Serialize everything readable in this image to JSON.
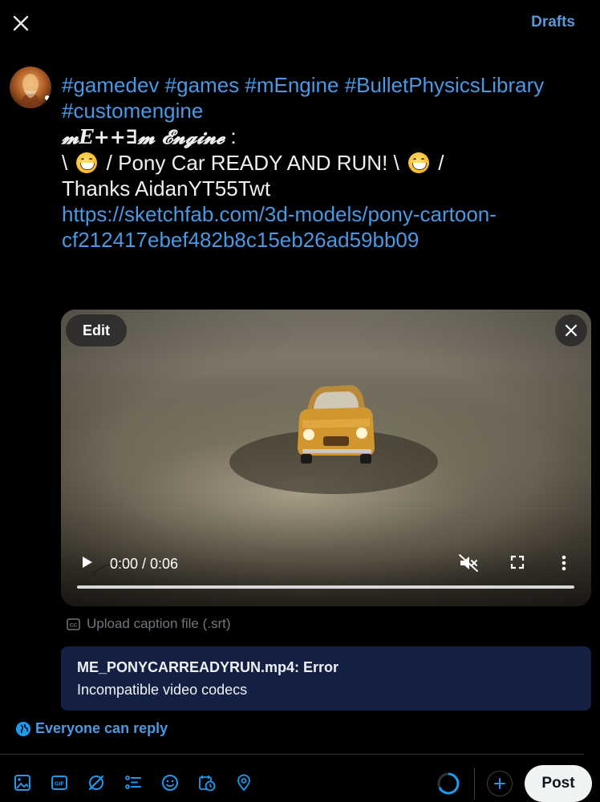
{
  "header": {
    "close_icon": "close-icon",
    "drafts_label": "Drafts"
  },
  "composer": {
    "line1": {
      "tag_gamedev": "#gamedev",
      "tag_games": "#games",
      "tag_mengine": "#mEngine",
      "tag_bullet": "#BulletPhysicsLibrary"
    },
    "line2": {
      "tag_customengine": "#customengine"
    },
    "line3": {
      "fancy_text": "𝓶E++∃𝓶 𝓔𝓷𝓰𝓲𝓷𝓮",
      "suffix": " :"
    },
    "line4": {
      "part1": "\\ ",
      "part2": " / Pony Car READY AND RUN! \\ ",
      "part3": " /"
    },
    "line5": "Thanks AidanYT55Twt",
    "link_line1": "https://sketchfab.com/3d-models/pony-cartoon-",
    "link_line2": "cf212417ebef482b8c15eb26ad59bb09"
  },
  "media": {
    "edit_label": "Edit",
    "time_display": "0:00 / 0:06",
    "progress": 0
  },
  "caption_upload_label": "Upload caption file (.srt)",
  "error": {
    "title": "ME_PONYCARREADYRUN.mp4: Error",
    "message": "Incompatible video codecs"
  },
  "reply_setting_label": "Everyone can reply",
  "toolbar": {
    "post_label": "Post",
    "icons": [
      "image-icon",
      "gif-icon",
      "grok-icon",
      "poll-icon",
      "emoji-icon",
      "schedule-icon",
      "location-icon"
    ]
  },
  "colors": {
    "accent": "#1d9bf0",
    "link": "#4a99e4",
    "background": "#000000",
    "error_bg": "#132044"
  }
}
